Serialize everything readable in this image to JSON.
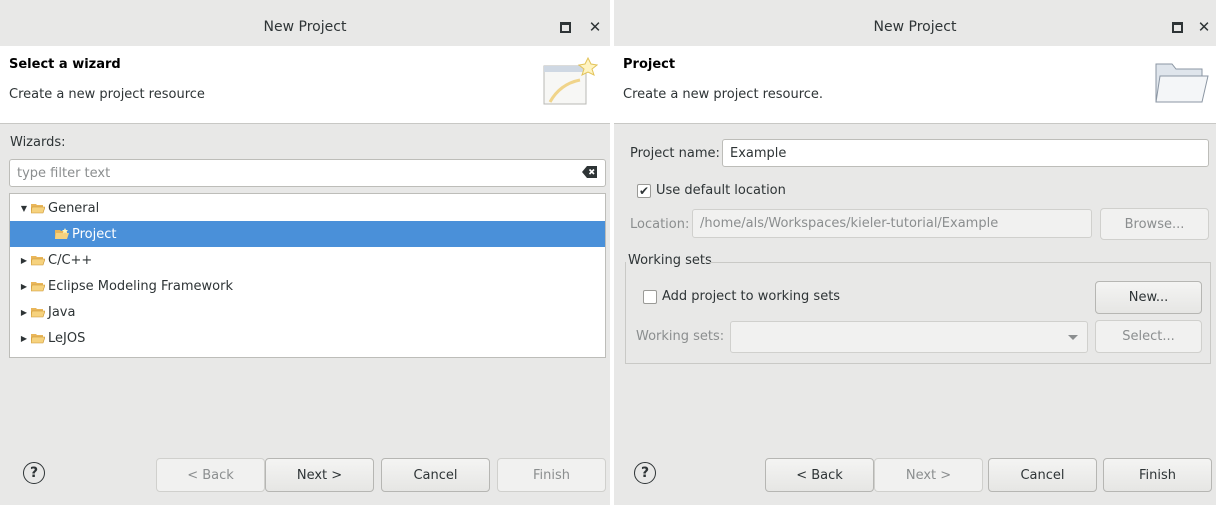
{
  "left_dialog": {
    "window_title": "New Project",
    "header": {
      "title": "Select a wizard",
      "description": "Create a new project resource"
    },
    "wizards_label": "Wizards:",
    "filter": {
      "placeholder": "type filter text"
    },
    "tree": [
      {
        "label": "General",
        "expanded": true,
        "selected": false
      },
      {
        "label": "Project",
        "selected": true
      },
      {
        "label": "C/C++",
        "expanded": false,
        "selected": false
      },
      {
        "label": "Eclipse Modeling Framework",
        "expanded": false,
        "selected": false
      },
      {
        "label": "Java",
        "expanded": false,
        "selected": false
      },
      {
        "label": "LeJOS",
        "expanded": false,
        "selected": false
      }
    ],
    "buttons": {
      "help": "?",
      "back": "< Back",
      "next": "Next >",
      "cancel": "Cancel",
      "finish": "Finish"
    }
  },
  "right_dialog": {
    "window_title": "New Project",
    "header": {
      "title": "Project",
      "description": "Create a new project resource."
    },
    "project_name_label": "Project name:",
    "project_name_value": "Example",
    "use_default_location": {
      "label": "Use default location",
      "checked": true
    },
    "location_label": "Location:",
    "location_value": "/home/als/Workspaces/kieler-tutorial/Example",
    "browse_button": "Browse...",
    "working_sets_group": "Working sets",
    "add_to_working_sets": {
      "label": "Add project to working sets",
      "checked": false
    },
    "new_button": "New...",
    "working_sets_label": "Working sets:",
    "working_sets_value": "",
    "select_button": "Select...",
    "buttons": {
      "help": "?",
      "back": "< Back",
      "next": "Next >",
      "cancel": "Cancel",
      "finish": "Finish"
    }
  },
  "colors": {
    "selection": "#4a90d9",
    "dialog_bg": "#e8e8e7"
  }
}
